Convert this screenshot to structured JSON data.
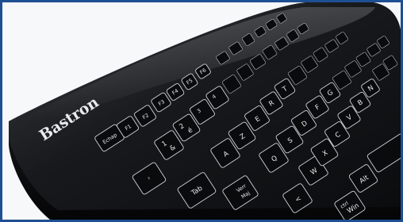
{
  "photo": {
    "frame_color": "#1e4f92",
    "brand": "Bastron",
    "keys": {
      "escape": "Echap",
      "f1": "F1",
      "f2": "F2",
      "f3": "F3",
      "f4": "F4",
      "f5": "F5",
      "f6": "F6",
      "num1": "1",
      "num1_alt": "&",
      "num2": "2",
      "num2_alt": "é",
      "num3": "3",
      "num4": "4",
      "sq": "²",
      "a": "A",
      "z": "Z",
      "e": "E",
      "r": "R",
      "t": "T",
      "q": "Q",
      "s": "S",
      "d": "D",
      "f": "F",
      "g": "G",
      "w": "W",
      "x": "X",
      "c": "C",
      "v": "V",
      "b": "B",
      "n": "N",
      "tab": "Tab",
      "caps_top": "Verr",
      "caps": "Maj",
      "less_than": "<",
      "alt": "Alt",
      "win": "Win",
      "ctrl": "ctrl"
    }
  }
}
